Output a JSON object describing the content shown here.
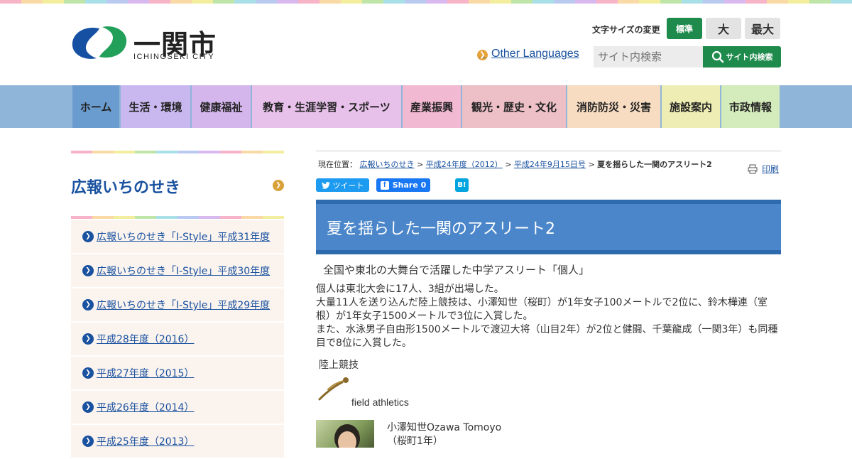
{
  "header": {
    "logo_text": "一関市",
    "logo_en": "ICHINOSEKI CITY",
    "font_size_label": "文字サイズの変更",
    "font_size_standard": "標準",
    "font_size_large": "大",
    "font_size_xlarge": "最大",
    "other_languages": "Other Languages",
    "search_placeholder": "サイト内検索",
    "search_button": "サイト内検索"
  },
  "nav": {
    "items": [
      {
        "label": "ホーム",
        "color": "#6b9ccf"
      },
      {
        "label": "生活・環境",
        "color": "#c9b8f0"
      },
      {
        "label": "健康福祉",
        "color": "#d4b6ec"
      },
      {
        "label": "教育・生涯学習・スポーツ",
        "color": "#e8c1ea"
      },
      {
        "label": "産業振興",
        "color": "#f2b9d2"
      },
      {
        "label": "観光・歴史・文化",
        "color": "#ecc0c6"
      },
      {
        "label": "消防防災・災害",
        "color": "#f7dcc2"
      },
      {
        "label": "施設案内",
        "color": "#eeeeb4"
      },
      {
        "label": "市政情報",
        "color": "#d4ecbc"
      }
    ]
  },
  "sidebar": {
    "title": "広報いちのせき",
    "items": [
      {
        "label": "広報いちのせき「I-Style」平成31年度"
      },
      {
        "label": "広報いちのせき「I-Style」平成30年度"
      },
      {
        "label": "広報いちのせき「I-Style」平成29年度"
      },
      {
        "label": "平成28年度（2016）"
      },
      {
        "label": "平成27年度（2015）"
      },
      {
        "label": "平成26年度（2014）"
      },
      {
        "label": "平成25年度（2013）"
      }
    ]
  },
  "breadcrumb": {
    "prefix": "現在位置：",
    "link1": "広報いちのせき",
    "link2": "平成24年度（2012）",
    "link3": "平成24年9月15日号",
    "current": "夏を揺らした一関のアスリート2",
    "sep": ">"
  },
  "print_label": "印刷",
  "social": {
    "tweet": "ツイート",
    "fb_share": "Share 0",
    "hatena": "B!"
  },
  "article": {
    "title": "夏を揺らした一関のアスリート2",
    "subhead": "全国や東北の大舞台で活躍した中学アスリート「個人」",
    "paragraphs": [
      "個人は東北大会に17人、3組が出場した。",
      "大量11人を送り込んだ陸上競技は、小澤知世（桜町）が1年女子100メートルで2位に、鈴木樺連（室根）が1年女子1500メートルで3位に入賞した。",
      "また、水泳男子自由形1500メートルで渡辺大将（山目2年）が2位と健闘、千葉龍成（一関3年）も同種目で8位に入賞した。"
    ],
    "sport_name": "陸上競技",
    "sport_icon": "athletics-icon",
    "sport_en": "field athletics",
    "athlete_name": "小澤知世Ozawa Tomoyo",
    "athlete_school": "（桜町1年）"
  },
  "colors": {
    "brand_green": "#1e8a4c",
    "link_blue": "#1a52a0",
    "title_blue": "#4a86c9"
  }
}
